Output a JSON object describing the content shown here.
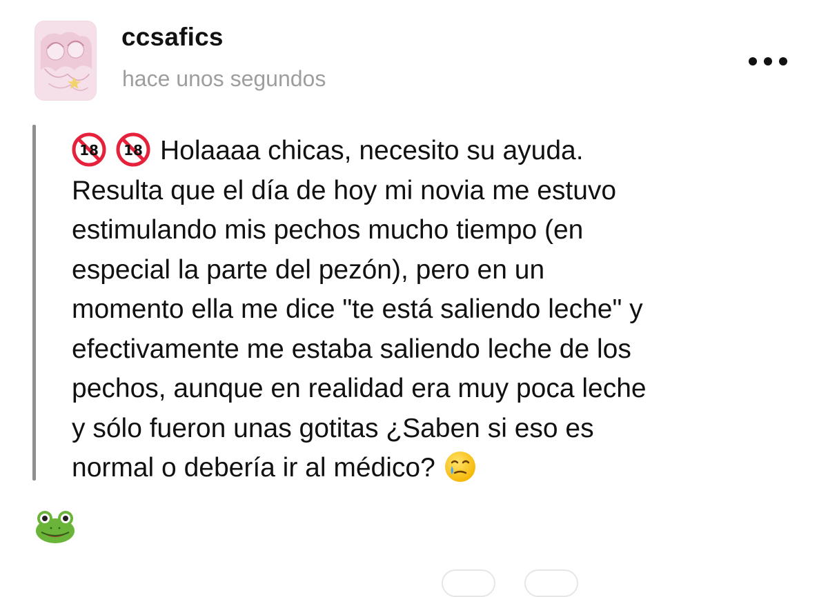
{
  "post": {
    "author": {
      "username": "ccsafics",
      "timestamp": "hace unos segundos",
      "avatar_icon": "anime-illustration-avatar"
    },
    "menu_icon": "more-horizontal-icon",
    "emojis": {
      "age_warning": "no-one-under-eighteen-emoji",
      "face": "face-holding-back-tears-emoji",
      "reaction": "frog-face-emoji"
    },
    "body_lines": [
      "Holaaaa chicas, necesito su ayuda.",
      "Resulta que el día de hoy mi novia me estuvo",
      "estimulando mis pechos mucho tiempo (en",
      "especial la parte del pezón), pero en un",
      "momento ella me dice \"te está saliendo leche\" y",
      "efectivamente me estaba saliendo leche de los",
      "pechos, aunque en realidad era muy poca leche",
      "y sólo fueron unas gotitas ¿Saben si eso es",
      "normal o debería ir al médico?"
    ],
    "colors": {
      "text": "#111111",
      "muted": "#9e9e9e",
      "quote_bar": "#8f8f8f",
      "warning_red": "#e5213c"
    }
  }
}
